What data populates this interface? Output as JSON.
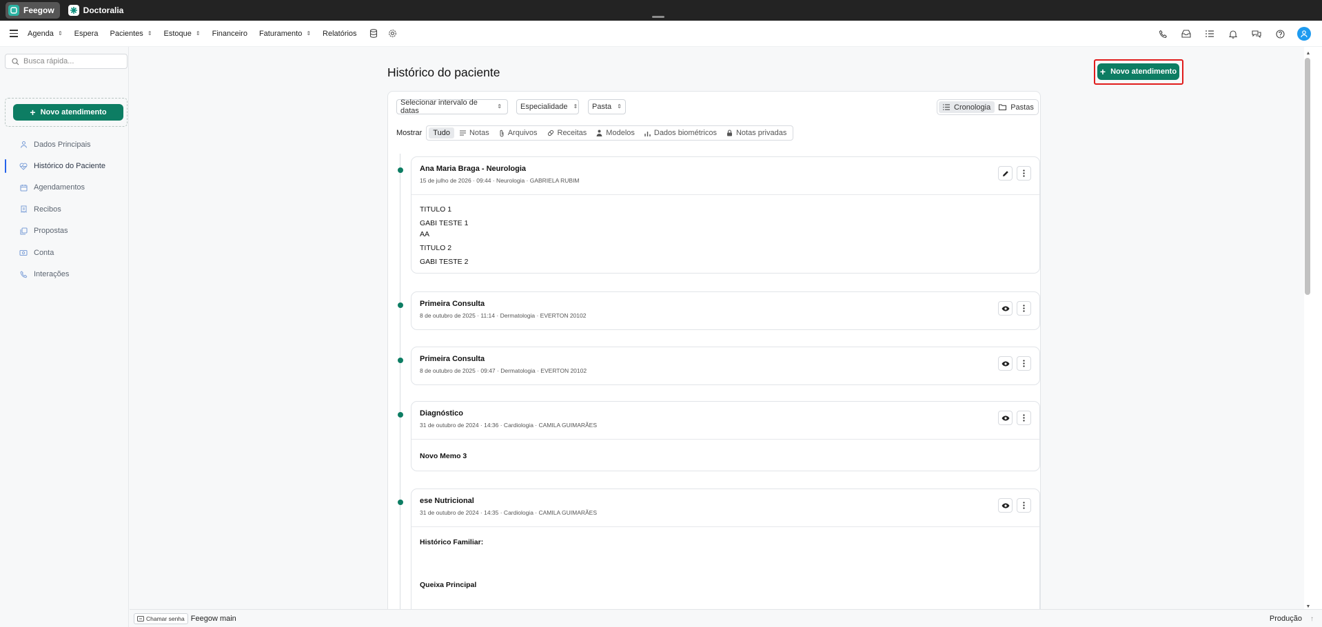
{
  "topbar": {
    "apps": [
      {
        "label": "Feegow",
        "active": true
      },
      {
        "label": "Doctoralia",
        "active": false
      }
    ]
  },
  "nav": {
    "items": [
      {
        "label": "Agenda",
        "caret": true
      },
      {
        "label": "Espera",
        "caret": false
      },
      {
        "label": "Pacientes",
        "caret": true
      },
      {
        "label": "Estoque",
        "caret": true
      },
      {
        "label": "Financeiro",
        "caret": false
      },
      {
        "label": "Faturamento",
        "caret": true
      },
      {
        "label": "Relatórios",
        "caret": false
      }
    ],
    "right_icons": [
      "phone-icon",
      "inbox-icon",
      "tasks-icon",
      "bell-icon",
      "chat-icon",
      "help-icon",
      "user-avatar"
    ]
  },
  "sidebar": {
    "search_placeholder": "Busca rápida...",
    "new_button": "Novo atendimento",
    "items": [
      {
        "label": "Dados Principais",
        "icon": "user-icon",
        "active": false
      },
      {
        "label": "Histórico do Paciente",
        "icon": "heart-icon",
        "active": true
      },
      {
        "label": "Agendamentos",
        "icon": "calendar-icon",
        "active": false
      },
      {
        "label": "Recibos",
        "icon": "receipt-icon",
        "active": false
      },
      {
        "label": "Propostas",
        "icon": "copy-icon",
        "active": false
      },
      {
        "label": "Conta",
        "icon": "money-icon",
        "active": false
      },
      {
        "label": "Interações",
        "icon": "phone-icon",
        "active": false
      }
    ]
  },
  "main": {
    "title": "Histórico do paciente",
    "new_button": "Novo atendimento",
    "filters": {
      "date_range": "Selecionar intervalo de datas",
      "specialty": "Especialidade",
      "folder": "Pasta"
    },
    "view_toggle": {
      "chronology": "Cronologia",
      "folders": "Pastas",
      "selected": "Cronologia"
    },
    "show_label": "Mostrar",
    "show_filters": [
      "Tudo",
      "Notas",
      "Arquivos",
      "Receitas",
      "Modelos",
      "Dados biométricos",
      "Notas privadas"
    ],
    "selected_filter": "Tudo"
  },
  "records": [
    {
      "title": "Ana Maria Braga - Neurologia",
      "meta": "15 de julho de 2026 · 09:44 · Neurologia · GABRIELA RUBIM",
      "action": "edit",
      "body": [
        "TITULO 1",
        "GABI TESTE 1",
        "AA",
        "TITULO 2",
        "GABI TESTE 2"
      ]
    },
    {
      "title": "Primeira Consulta",
      "meta": "8 de outubro de 2025 · 11:14 · Dermatologia · EVERTON 20102",
      "action": "view",
      "body": []
    },
    {
      "title": "Primeira Consulta",
      "meta": "8 de outubro de 2025 · 09:47 · Dermatologia · EVERTON 20102",
      "action": "view",
      "body": []
    },
    {
      "title": "Diagnóstico",
      "meta": "31 de outubro de 2024 · 14:36 · Cardiologia · CAMILA GUIMARÃES",
      "action": "view",
      "body": [
        "Novo Memo 3"
      ]
    },
    {
      "title": "ese Nutricional",
      "meta": "31 de outubro de 2024 · 14:35 · Cardiologia · CAMILA GUIMARÃES",
      "action": "view",
      "body": [
        "Histórico Familiar:",
        "Queixa Principal"
      ]
    }
  ],
  "statusbar": {
    "call_button": "Chamar senha",
    "unit": "Feegow main",
    "environment": "Produção"
  },
  "colors": {
    "accent": "#0d7d63",
    "highlight": "#e01b1b",
    "topbar": "#232323"
  }
}
